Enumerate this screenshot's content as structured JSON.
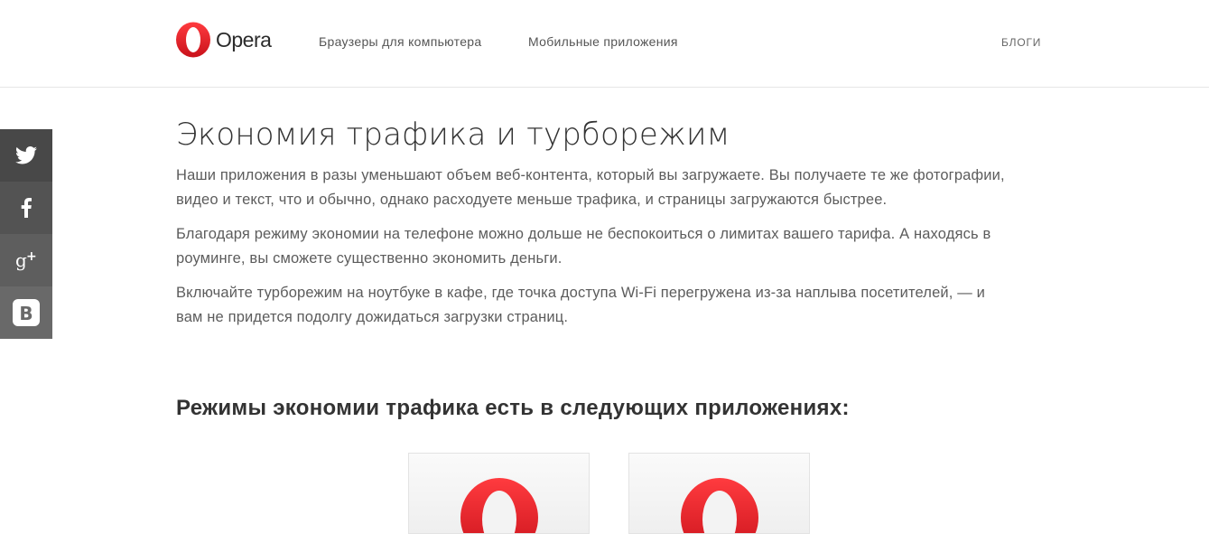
{
  "header": {
    "logo_text": "Opera",
    "nav": {
      "desktop": "Браузеры для компьютера",
      "mobile": "Мобильные приложения",
      "blogs": "БЛОГИ"
    }
  },
  "social": [
    {
      "icon": "twitter-icon"
    },
    {
      "icon": "facebook-icon"
    },
    {
      "icon": "google-plus-icon"
    },
    {
      "icon": "vk-icon"
    }
  ],
  "main": {
    "title": "Экономия трафика и турборежим",
    "paragraphs": [
      "Наши приложения в разы уменьшают объем веб-контента, который вы загружаете. Вы получаете те же фотографии, видео и текст, что и обычно, однако расходуете меньше трафика, и страницы загружаются быстрее.",
      "Благодаря режиму экономии на телефоне можно дольше не беспокоиться о лимитах вашего тарифа. А находясь в роуминге, вы сможете существенно экономить деньги.",
      "Включайте турборежим на ноутбуке в кафе, где точка доступа Wi-Fi перегружена из-за наплыва посетителей, — и вам не придется подолгу дожидаться загрузки страниц."
    ],
    "apps_heading": "Режимы экономии трафика есть в следующих приложениях:"
  },
  "colors": {
    "brand_red": "#e8262e",
    "text_dark": "#333333",
    "text_body": "#5c5c5c"
  }
}
